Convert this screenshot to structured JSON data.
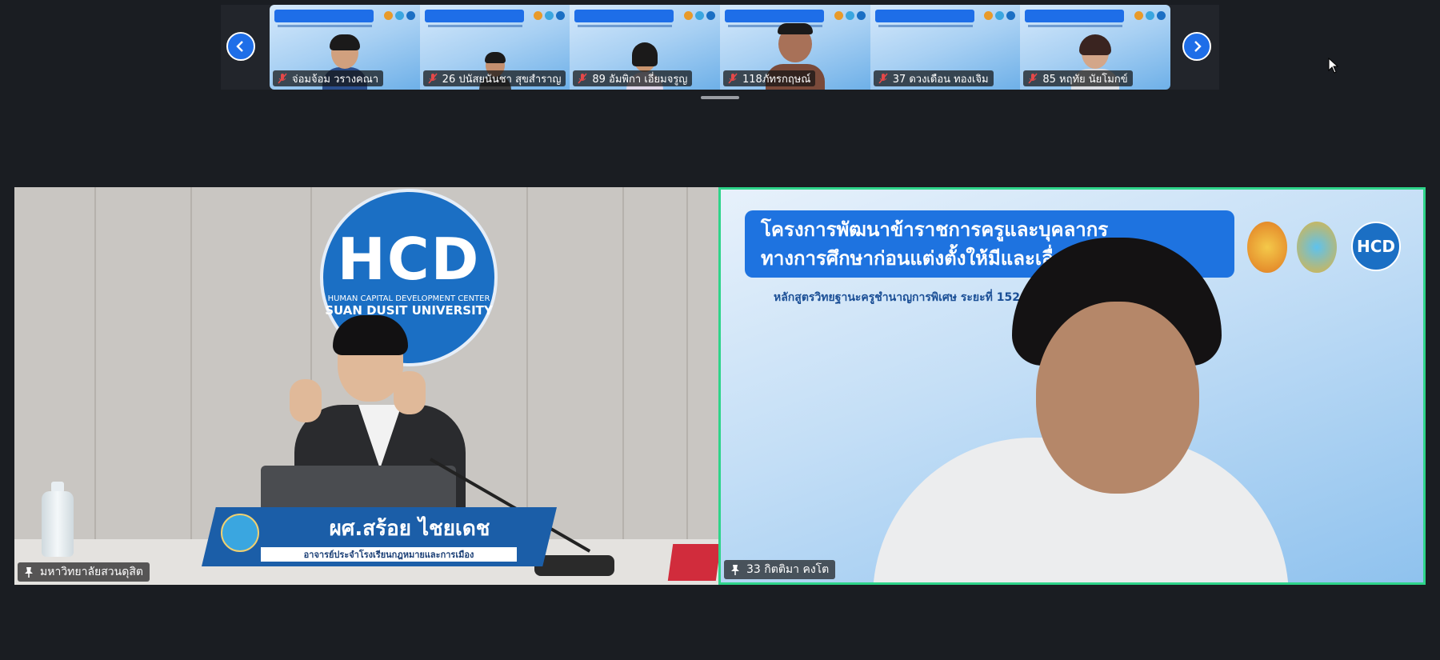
{
  "filmstrip": {
    "prev_label": "previous",
    "next_label": "next",
    "participants": [
      {
        "name": "จ่อมจ้อม วรางคณา"
      },
      {
        "name": "26 ปนัสยนันชา สุขสำราญ"
      },
      {
        "name": "89 อัมพิกา เอี่ยมจรูญ"
      },
      {
        "name": "118ภัทรกฤษณ์"
      },
      {
        "name": "37 ดวงเดือน ทองเจิม"
      },
      {
        "name": "85 หฤทัย นัยโมกข์"
      }
    ]
  },
  "tiles": {
    "left": {
      "label": "มหาวิทยาลัยสวนดุสิต",
      "logo_big": "HCD",
      "logo_line1": "HUMAN CAPITAL DEVELOPMENT CENTER",
      "logo_line2": "SUAN DUSIT UNIVERSITY",
      "nameplate_name": "ผศ.สร้อย ไชยเดช",
      "nameplate_title": "อาจารย์ประจำโรงเรียนกฎหมายและการเมือง"
    },
    "right": {
      "label": "33 กิตติมา คงโต",
      "banner_line1": "โครงการพัฒนาข้าราชการครูและบุคลากร",
      "banner_line2": "ทางการศึกษาก่อนแต่งตั้งให้มีและเลื่",
      "banner_sub": "หลักสูตรวิทยฐานะครูชำนาญการพิเศษ ระยะที่ 152 วันที่",
      "logo_text": "HCD"
    }
  },
  "colors": {
    "background": "#1a1d22",
    "accent_blue": "#1e6ee8",
    "active_speaker_border": "#2ed48a"
  }
}
